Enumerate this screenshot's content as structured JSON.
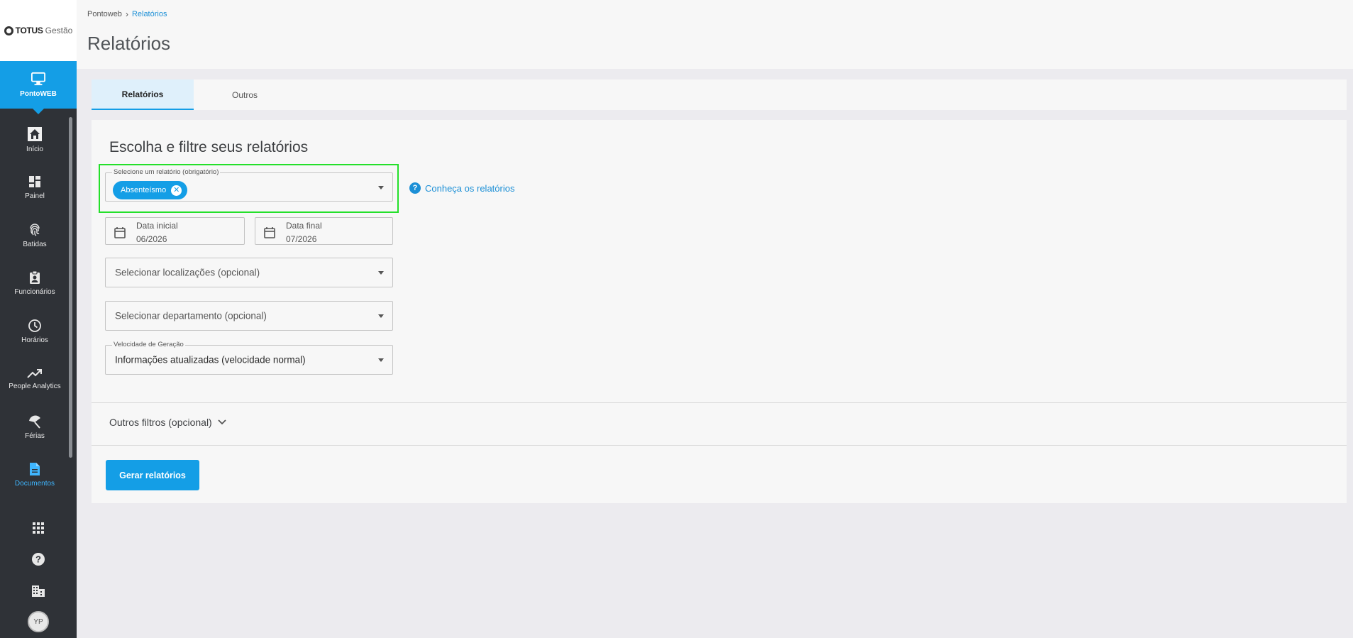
{
  "sidebar": {
    "logo": {
      "brand": "TOTUS",
      "product": "Gestão"
    },
    "current_app": {
      "label": "PontoWEB",
      "icon": "monitor-icon"
    },
    "items": [
      {
        "label": "Início",
        "icon": "home-icon",
        "active": false
      },
      {
        "label": "Painel",
        "icon": "dashboard-icon",
        "active": false
      },
      {
        "label": "Batidas",
        "icon": "fingerprint-icon",
        "active": false
      },
      {
        "label": "Funcionários",
        "icon": "badge-icon",
        "active": false
      },
      {
        "label": "Horários",
        "icon": "clock-icon",
        "active": false
      },
      {
        "label": "People Analytics",
        "icon": "trending-up-icon",
        "active": false
      },
      {
        "label": "Férias",
        "icon": "umbrella-icon",
        "active": false
      },
      {
        "label": "Documentos",
        "icon": "document-icon",
        "active": true
      }
    ],
    "bottom": {
      "apps_icon": "grid-icon",
      "help_icon": "help-icon",
      "company_icon": "building-icon",
      "avatar_initials": "YP"
    }
  },
  "breadcrumb": {
    "parent": "Pontoweb",
    "current": "Relatórios"
  },
  "page_title": "Relatórios",
  "tabs": [
    {
      "label": "Relatórios",
      "active": true
    },
    {
      "label": "Outros",
      "active": false
    }
  ],
  "form": {
    "title": "Escolha e filtre seus relatórios",
    "report_select": {
      "legend": "Selecione um relatório (obrigatório)",
      "chip": "Absenteísmo"
    },
    "help_link": "Conheça os relatórios",
    "start_date": {
      "label": "Data inicial",
      "value": "06/2026"
    },
    "end_date": {
      "label": "Data final",
      "value": "07/2026"
    },
    "locations_placeholder": "Selecionar localizações (opcional)",
    "department_placeholder": "Selecionar departamento (opcional)",
    "speed": {
      "legend": "Velocidade de Geração",
      "value": "Informações atualizadas (velocidade normal)"
    },
    "other_filters": "Outros filtros (opcional)",
    "generate_button": "Gerar relatórios"
  },
  "colors": {
    "primary": "#149ee6",
    "sidebar": "#2f3237",
    "highlight": "#24e02a"
  }
}
